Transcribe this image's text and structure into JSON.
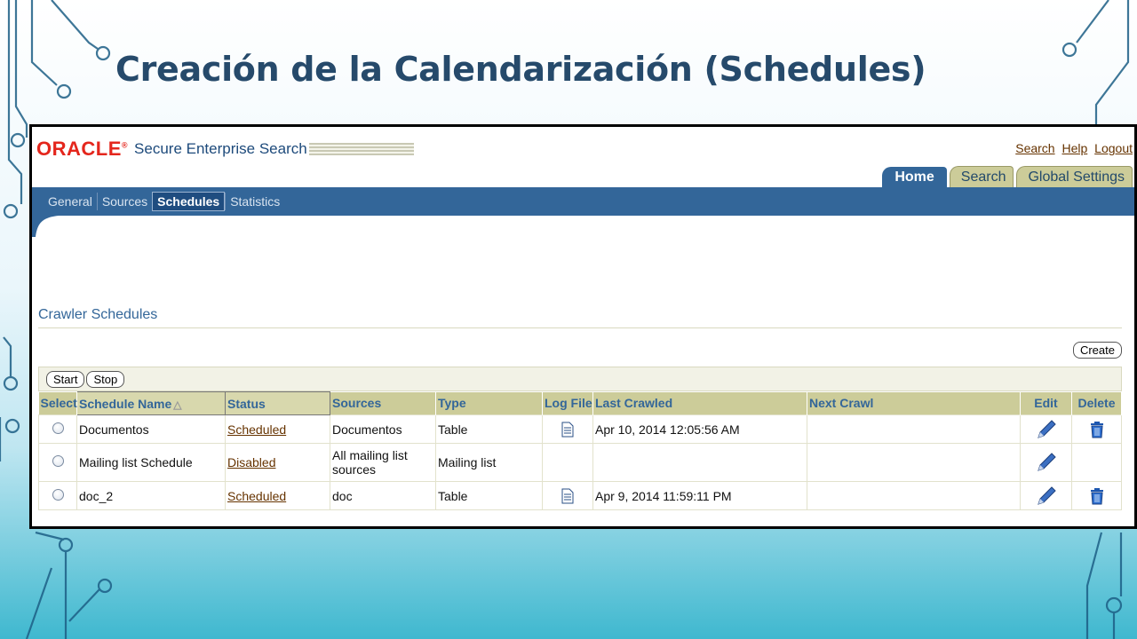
{
  "slide": {
    "title": "Creación de la Calendarización (Schedules)"
  },
  "colors": {
    "accent": "#336699",
    "brand": "#e4261c",
    "header_cell": "#cccc99",
    "link": "#663300"
  },
  "header": {
    "logo_text": "ORACLE",
    "logo_mark": "®",
    "product_name": "Secure Enterprise Search",
    "global_links": [
      "Search",
      "Help",
      "Logout"
    ]
  },
  "tabs": [
    {
      "label": "Home",
      "active": true
    },
    {
      "label": "Search",
      "active": false
    },
    {
      "label": "Global Settings",
      "active": false
    }
  ],
  "subnav": [
    {
      "label": "General",
      "active": false
    },
    {
      "label": "Sources",
      "active": false
    },
    {
      "label": "Schedules",
      "active": true
    },
    {
      "label": "Statistics",
      "active": false
    }
  ],
  "main": {
    "section_title": "Crawler Schedules",
    "create_label": "Create",
    "start_label": "Start",
    "stop_label": "Stop",
    "sort_indicator": "△",
    "columns": [
      "Select",
      "Schedule Name",
      "Status",
      "Sources",
      "Type",
      "Log File",
      "Last Crawled",
      "Next Crawl",
      "Edit",
      "Delete"
    ],
    "rows": [
      {
        "name": "Documentos",
        "status": "Scheduled",
        "sources": "Documentos",
        "type": "Table",
        "has_log": true,
        "last_crawled": "Apr 10, 2014 12:05:56 AM",
        "next_crawl": "",
        "has_delete": true
      },
      {
        "name": "Mailing list Schedule",
        "status": "Disabled",
        "sources": "All mailing list sources",
        "type": "Mailing list",
        "has_log": false,
        "last_crawled": "",
        "next_crawl": "",
        "has_delete": false
      },
      {
        "name": "doc_2",
        "status": "Scheduled",
        "sources": "doc",
        "type": "Table",
        "has_log": true,
        "last_crawled": "Apr 9, 2014 11:59:11 PM",
        "next_crawl": "",
        "has_delete": true
      }
    ],
    "icons": {
      "log": "document-icon",
      "edit": "pencil-icon",
      "delete": "trash-icon",
      "select": "radio-icon"
    }
  }
}
